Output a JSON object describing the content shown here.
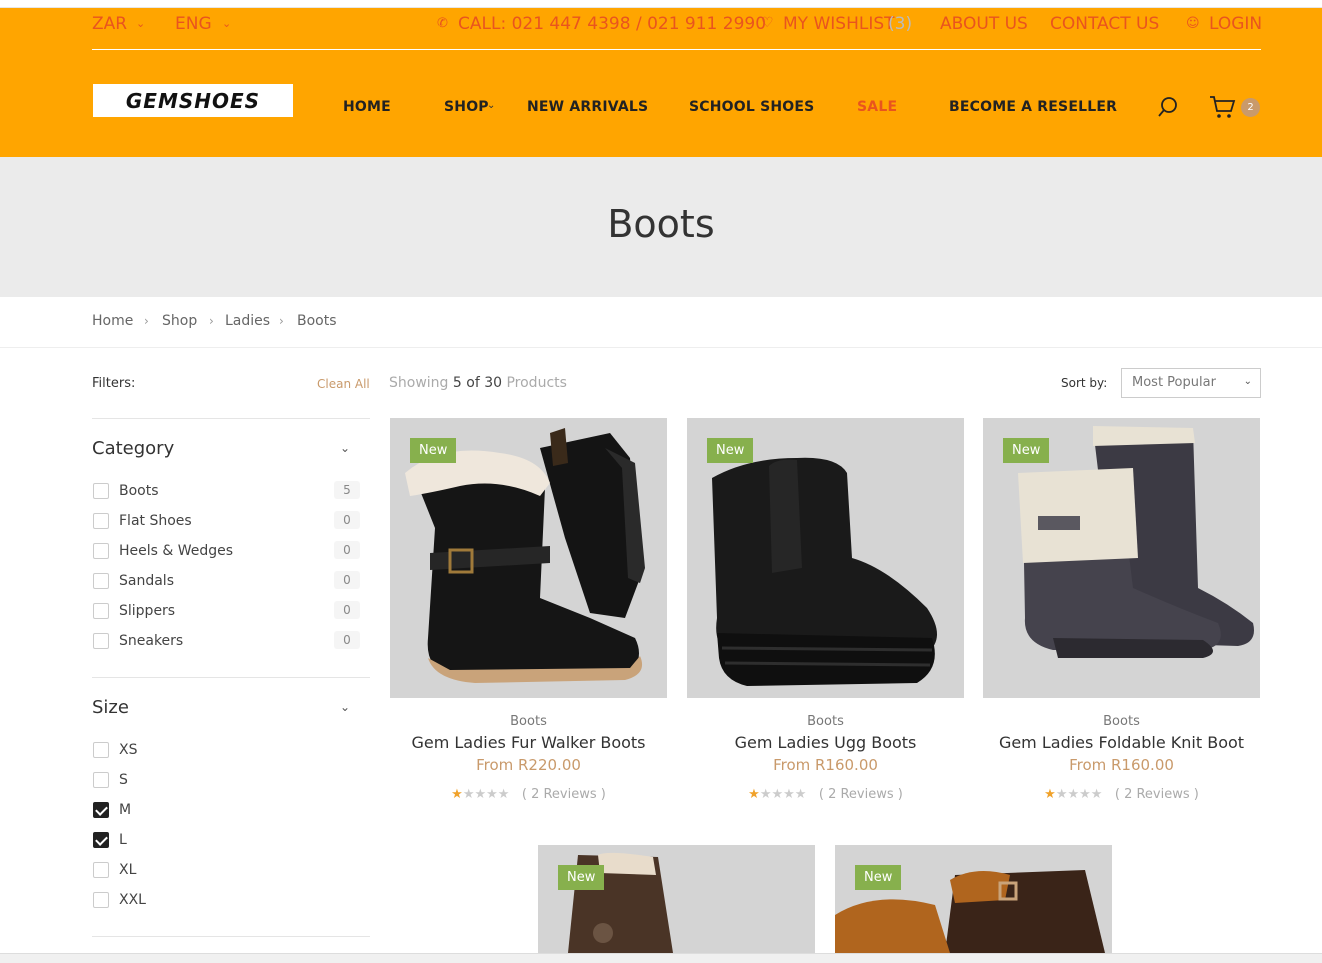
{
  "topbar": {
    "currency": "ZAR",
    "language": "ENG",
    "phone": "CALL: 021 447 4398 / 021 911 2990",
    "wishlist_label": "MY WISHLIST",
    "wishlist_count": "(3)",
    "about": "ABOUT US",
    "contact": "CONTACT US",
    "login": "LOGIN"
  },
  "brand": {
    "logo_text": "GEMSHOES"
  },
  "nav": {
    "home": "HOME",
    "shop": "SHOP",
    "new_arrivals": "NEW ARRIVALS",
    "school_shoes": "SCHOOL SHOES",
    "sale": "SALE",
    "reseller": "BECOME A RESELLER",
    "cart_count": "2"
  },
  "page_title": "Boots",
  "breadcrumb": [
    "Home",
    "Shop",
    "Ladies",
    "Boots"
  ],
  "filters": {
    "label": "Filters:",
    "clean_all": "Clean All",
    "category": {
      "title": "Category",
      "items": [
        {
          "label": "Boots",
          "count": "5"
        },
        {
          "label": "Flat Shoes",
          "count": "0"
        },
        {
          "label": "Heels & Wedges",
          "count": "0"
        },
        {
          "label": "Sandals",
          "count": "0"
        },
        {
          "label": "Slippers",
          "count": "0"
        },
        {
          "label": "Sneakers",
          "count": "0"
        }
      ]
    },
    "size": {
      "title": "Size",
      "items": [
        {
          "label": "XS",
          "checked": false
        },
        {
          "label": "S",
          "checked": false
        },
        {
          "label": "M",
          "checked": true
        },
        {
          "label": "L",
          "checked": true
        },
        {
          "label": "XL",
          "checked": false
        },
        {
          "label": "XXL",
          "checked": false
        }
      ]
    }
  },
  "toolbar": {
    "showing_prefix": "Showing",
    "showing_count": "5 of 30",
    "showing_suffix": "Products",
    "sort_label": "Sort by:",
    "sort_value": "Most Popular"
  },
  "products": [
    {
      "badge": "New",
      "category": "Boots",
      "name": "Gem Ladies Fur Walker Boots",
      "price": "From R220.00",
      "reviews": "( 2 Reviews )",
      "rating": 1
    },
    {
      "badge": "New",
      "category": "Boots",
      "name": "Gem Ladies Ugg Boots",
      "price": "From R160.00",
      "reviews": "( 2 Reviews )",
      "rating": 1
    },
    {
      "badge": "New",
      "category": "Boots",
      "name": "Gem Ladies Foldable Knit Boot",
      "price": "From R160.00",
      "reviews": "( 2 Reviews )",
      "rating": 1
    },
    {
      "badge": "New"
    },
    {
      "badge": "New"
    }
  ],
  "colors": {
    "header_bg": "#ffa500",
    "accent_orange": "#e9541e",
    "price_tan": "#c99a6b",
    "badge_green": "#87b04d",
    "star": "#f0a22b"
  }
}
